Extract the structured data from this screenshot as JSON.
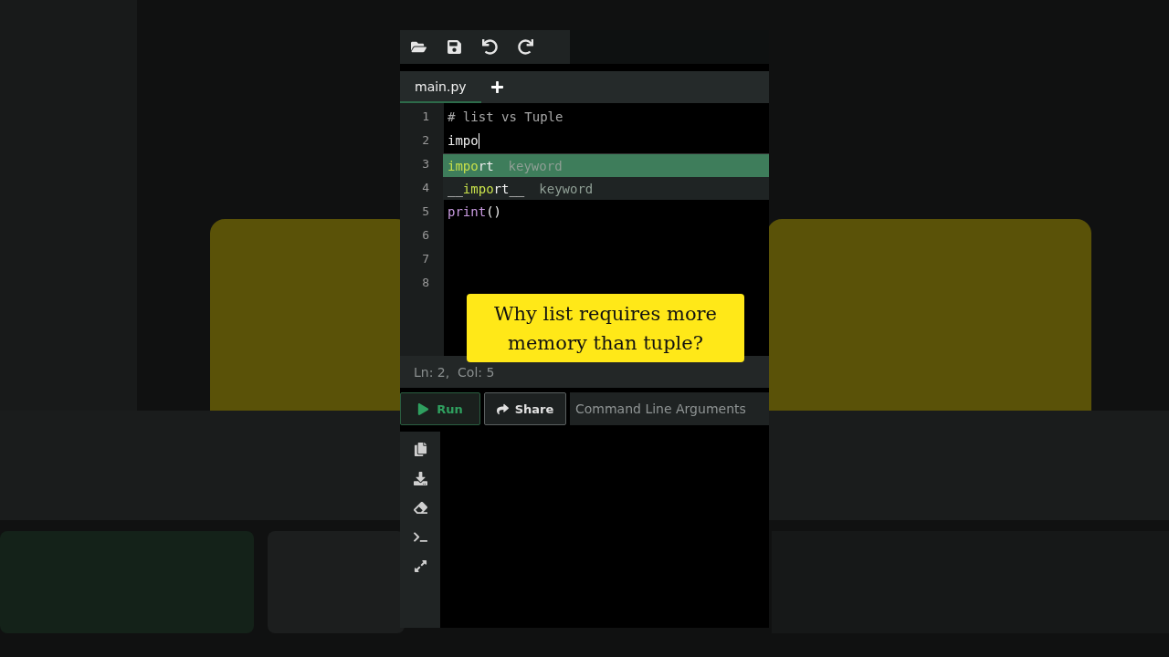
{
  "toolbar": {
    "buttons": [
      {
        "kind": "open"
      },
      {
        "kind": "save"
      },
      {
        "kind": "undo"
      },
      {
        "kind": "redo"
      }
    ]
  },
  "tabs": [
    {
      "label": "main.py",
      "selected": true
    }
  ],
  "editor": {
    "lines": [
      {
        "number": "1",
        "segments": [
          {
            "text": "# list vs Tuple",
            "kind": "comment"
          }
        ]
      },
      {
        "number": "2",
        "cursor": true,
        "segments": [
          {
            "text": "impo",
            "kind": "plain"
          }
        ]
      },
      {
        "number": "3"
      },
      {
        "number": "4"
      },
      {
        "number": "5",
        "segments": [
          {
            "text": "print",
            "kind": "builtin"
          },
          {
            "text": "()",
            "kind": "plain"
          }
        ]
      },
      {
        "number": "6"
      },
      {
        "number": "7"
      },
      {
        "number": "8"
      }
    ],
    "suggestions": [
      {
        "selected": true,
        "segments": [
          {
            "text": "impo",
            "kind": "match"
          },
          {
            "text": "rt",
            "kind": "plain"
          }
        ],
        "detail": "keyword"
      },
      {
        "selected": false,
        "segments": [
          {
            "text": "__",
            "kind": "plain"
          },
          {
            "text": "impo",
            "kind": "match"
          },
          {
            "text": "rt__",
            "kind": "plain"
          }
        ],
        "detail": "keyword"
      }
    ]
  },
  "caption": "Why list requires more memory than tuple?",
  "status_bar": {
    "position": "Ln: 2,  Col: 5"
  },
  "actions": {
    "run": "Run",
    "share": "Share",
    "arguments": {
      "placeholder": "Command Line Arguments"
    }
  },
  "side_tools": [
    {
      "kind": "copy"
    },
    {
      "kind": "download"
    },
    {
      "kind": "clear"
    },
    {
      "kind": "terminal"
    },
    {
      "kind": "expand"
    }
  ]
}
